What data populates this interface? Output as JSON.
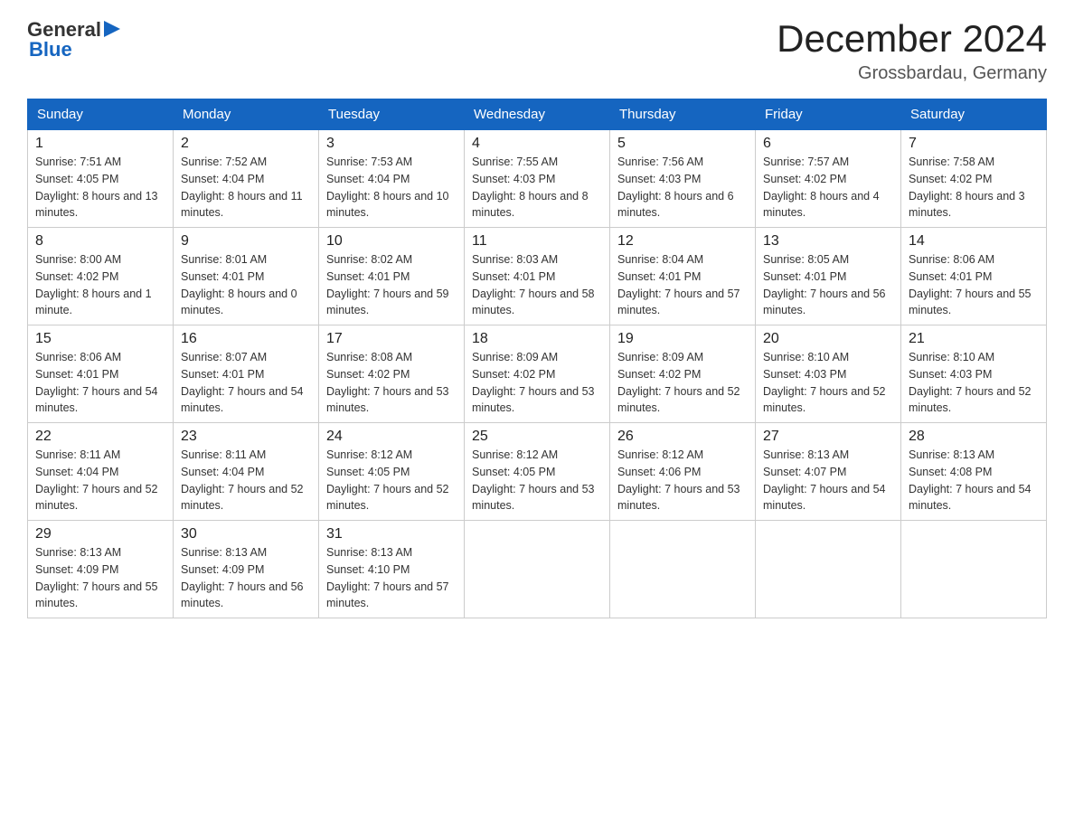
{
  "header": {
    "logo_general": "General",
    "logo_blue": "Blue",
    "title": "December 2024",
    "subtitle": "Grossbardau, Germany"
  },
  "days_of_week": [
    "Sunday",
    "Monday",
    "Tuesday",
    "Wednesday",
    "Thursday",
    "Friday",
    "Saturday"
  ],
  "weeks": [
    [
      {
        "day": "1",
        "sunrise": "7:51 AM",
        "sunset": "4:05 PM",
        "daylight": "8 hours and 13 minutes."
      },
      {
        "day": "2",
        "sunrise": "7:52 AM",
        "sunset": "4:04 PM",
        "daylight": "8 hours and 11 minutes."
      },
      {
        "day": "3",
        "sunrise": "7:53 AM",
        "sunset": "4:04 PM",
        "daylight": "8 hours and 10 minutes."
      },
      {
        "day": "4",
        "sunrise": "7:55 AM",
        "sunset": "4:03 PM",
        "daylight": "8 hours and 8 minutes."
      },
      {
        "day": "5",
        "sunrise": "7:56 AM",
        "sunset": "4:03 PM",
        "daylight": "8 hours and 6 minutes."
      },
      {
        "day": "6",
        "sunrise": "7:57 AM",
        "sunset": "4:02 PM",
        "daylight": "8 hours and 4 minutes."
      },
      {
        "day": "7",
        "sunrise": "7:58 AM",
        "sunset": "4:02 PM",
        "daylight": "8 hours and 3 minutes."
      }
    ],
    [
      {
        "day": "8",
        "sunrise": "8:00 AM",
        "sunset": "4:02 PM",
        "daylight": "8 hours and 1 minute."
      },
      {
        "day": "9",
        "sunrise": "8:01 AM",
        "sunset": "4:01 PM",
        "daylight": "8 hours and 0 minutes."
      },
      {
        "day": "10",
        "sunrise": "8:02 AM",
        "sunset": "4:01 PM",
        "daylight": "7 hours and 59 minutes."
      },
      {
        "day": "11",
        "sunrise": "8:03 AM",
        "sunset": "4:01 PM",
        "daylight": "7 hours and 58 minutes."
      },
      {
        "day": "12",
        "sunrise": "8:04 AM",
        "sunset": "4:01 PM",
        "daylight": "7 hours and 57 minutes."
      },
      {
        "day": "13",
        "sunrise": "8:05 AM",
        "sunset": "4:01 PM",
        "daylight": "7 hours and 56 minutes."
      },
      {
        "day": "14",
        "sunrise": "8:06 AM",
        "sunset": "4:01 PM",
        "daylight": "7 hours and 55 minutes."
      }
    ],
    [
      {
        "day": "15",
        "sunrise": "8:06 AM",
        "sunset": "4:01 PM",
        "daylight": "7 hours and 54 minutes."
      },
      {
        "day": "16",
        "sunrise": "8:07 AM",
        "sunset": "4:01 PM",
        "daylight": "7 hours and 54 minutes."
      },
      {
        "day": "17",
        "sunrise": "8:08 AM",
        "sunset": "4:02 PM",
        "daylight": "7 hours and 53 minutes."
      },
      {
        "day": "18",
        "sunrise": "8:09 AM",
        "sunset": "4:02 PM",
        "daylight": "7 hours and 53 minutes."
      },
      {
        "day": "19",
        "sunrise": "8:09 AM",
        "sunset": "4:02 PM",
        "daylight": "7 hours and 52 minutes."
      },
      {
        "day": "20",
        "sunrise": "8:10 AM",
        "sunset": "4:03 PM",
        "daylight": "7 hours and 52 minutes."
      },
      {
        "day": "21",
        "sunrise": "8:10 AM",
        "sunset": "4:03 PM",
        "daylight": "7 hours and 52 minutes."
      }
    ],
    [
      {
        "day": "22",
        "sunrise": "8:11 AM",
        "sunset": "4:04 PM",
        "daylight": "7 hours and 52 minutes."
      },
      {
        "day": "23",
        "sunrise": "8:11 AM",
        "sunset": "4:04 PM",
        "daylight": "7 hours and 52 minutes."
      },
      {
        "day": "24",
        "sunrise": "8:12 AM",
        "sunset": "4:05 PM",
        "daylight": "7 hours and 52 minutes."
      },
      {
        "day": "25",
        "sunrise": "8:12 AM",
        "sunset": "4:05 PM",
        "daylight": "7 hours and 53 minutes."
      },
      {
        "day": "26",
        "sunrise": "8:12 AM",
        "sunset": "4:06 PM",
        "daylight": "7 hours and 53 minutes."
      },
      {
        "day": "27",
        "sunrise": "8:13 AM",
        "sunset": "4:07 PM",
        "daylight": "7 hours and 54 minutes."
      },
      {
        "day": "28",
        "sunrise": "8:13 AM",
        "sunset": "4:08 PM",
        "daylight": "7 hours and 54 minutes."
      }
    ],
    [
      {
        "day": "29",
        "sunrise": "8:13 AM",
        "sunset": "4:09 PM",
        "daylight": "7 hours and 55 minutes."
      },
      {
        "day": "30",
        "sunrise": "8:13 AM",
        "sunset": "4:09 PM",
        "daylight": "7 hours and 56 minutes."
      },
      {
        "day": "31",
        "sunrise": "8:13 AM",
        "sunset": "4:10 PM",
        "daylight": "7 hours and 57 minutes."
      },
      null,
      null,
      null,
      null
    ]
  ]
}
